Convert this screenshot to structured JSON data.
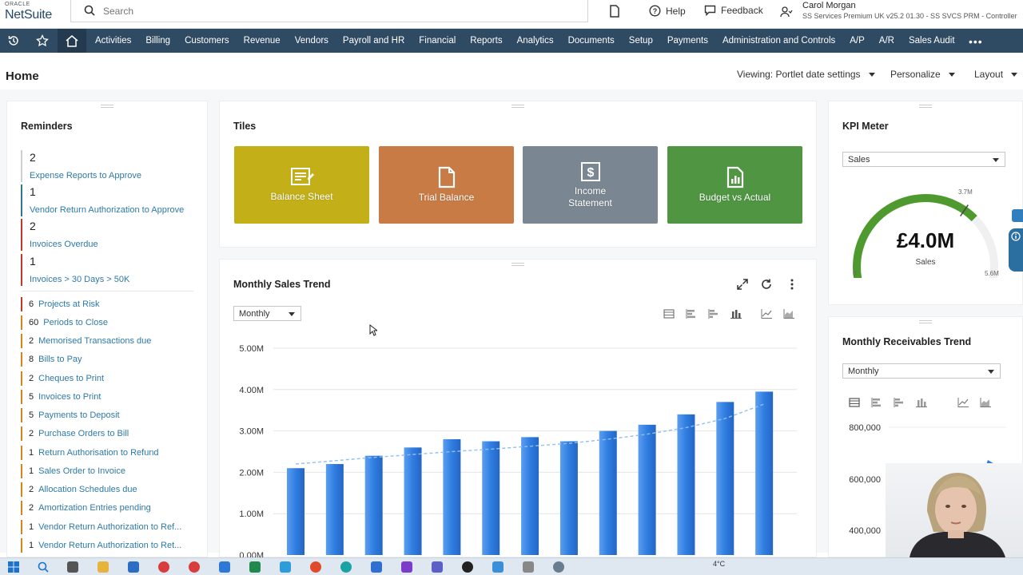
{
  "app": {
    "logo_top": "ORACLE",
    "logo_name": "NetSuite",
    "search_placeholder": "Search",
    "help_label": "Help",
    "feedback_label": "Feedback",
    "user_name": "Carol Morgan",
    "user_role": "SS Services Premium UK v25.2 01.30 - SS SVCS PRM - Controller"
  },
  "nav": {
    "items": [
      "Activities",
      "Billing",
      "Customers",
      "Revenue",
      "Vendors",
      "Payroll and HR",
      "Financial",
      "Reports",
      "Analytics",
      "Documents",
      "Setup",
      "Payments",
      "Administration and Controls",
      "A/P",
      "A/R",
      "Sales Audit"
    ],
    "more": "•••"
  },
  "header": {
    "title": "Home",
    "viewing": "Viewing: Portlet date settings",
    "personalize": "Personalize",
    "layout": "Layout"
  },
  "reminders": {
    "title": "Reminders",
    "big": [
      {
        "count": "2",
        "label": "Expense Reports to Approve",
        "color": "#cfcfcf"
      },
      {
        "count": "1",
        "label": "Vendor Return Authorization to Approve",
        "color": "#2b7a8c"
      },
      {
        "count": "2",
        "label": "Invoices Overdue",
        "color": "#c0392b"
      },
      {
        "count": "1",
        "label": "Invoices > 30 Days > 50K",
        "color": "#c0392b"
      }
    ],
    "small": [
      {
        "count": "6",
        "label": "Projects at Risk",
        "color": "#c0392b"
      },
      {
        "count": "60",
        "label": "Periods to Close",
        "color": "#d4841a"
      },
      {
        "count": "2",
        "label": "Memorised Transactions due",
        "color": "#d4841a"
      },
      {
        "count": "8",
        "label": "Bills to Pay",
        "color": "#d4841a"
      },
      {
        "count": "2",
        "label": "Cheques to Print",
        "color": "#d4841a"
      },
      {
        "count": "5",
        "label": "Invoices to Print",
        "color": "#d4841a"
      },
      {
        "count": "5",
        "label": "Payments to Deposit",
        "color": "#d4841a"
      },
      {
        "count": "2",
        "label": "Purchase Orders to Bill",
        "color": "#d4841a"
      },
      {
        "count": "1",
        "label": "Return Authorisation to Refund",
        "color": "#d4841a"
      },
      {
        "count": "1",
        "label": "Sales Order to Invoice",
        "color": "#d4841a"
      },
      {
        "count": "2",
        "label": "Allocation Schedules due",
        "color": "#d4841a"
      },
      {
        "count": "2",
        "label": "Amortization Entries pending",
        "color": "#d4841a"
      },
      {
        "count": "1",
        "label": "Vendor Return Authorization to Ref...",
        "color": "#d4841a"
      },
      {
        "count": "1",
        "label": "Vendor Return Authorization to Ret...",
        "color": "#d4841a"
      }
    ]
  },
  "tiles": {
    "title": "Tiles",
    "items": [
      {
        "label": "Balance Sheet",
        "color": "#c3b019",
        "icon": "balance-sheet-icon"
      },
      {
        "label": "Trial Balance",
        "color": "#c97b45",
        "icon": "document-icon"
      },
      {
        "label": "Income Statement",
        "color": "#7a8691",
        "icon": "dollar-doc-icon"
      },
      {
        "label": "Budget vs Actual",
        "color": "#4f9542",
        "icon": "chart-doc-icon"
      }
    ]
  },
  "sales_trend": {
    "title": "Monthly Sales Trend",
    "period": "Monthly"
  },
  "kpi": {
    "title": "KPI Meter",
    "select": "Sales",
    "value": "£4.0M",
    "label": "Sales",
    "min": "0",
    "target": "3.7M",
    "max": "5.6M",
    "fill_fraction": 0.71
  },
  "receivables": {
    "title": "Monthly Receivables Trend",
    "period": "Monthly"
  },
  "taskbar": {
    "weather": "4°C"
  },
  "chart_data": [
    {
      "type": "bar",
      "title": "Monthly Sales Trend",
      "xlabel": "",
      "ylabel": "",
      "ylim": [
        0,
        5.0
      ],
      "ytick_labels": [
        "0.00M",
        "1.00M",
        "2.00M",
        "3.00M",
        "4.00M",
        "5.00M"
      ],
      "values": [
        2.1,
        2.2,
        2.4,
        2.6,
        2.8,
        2.75,
        2.85,
        2.75,
        3.0,
        3.15,
        3.4,
        3.7,
        3.95
      ],
      "trend": [
        2.2,
        2.28,
        2.36,
        2.43,
        2.5,
        2.56,
        2.63,
        2.7,
        2.8,
        2.92,
        3.08,
        3.3,
        3.65
      ],
      "color": "#2f7de1",
      "grid": true
    },
    {
      "type": "bar",
      "title": "Monthly Receivables Trend",
      "ytick_labels": [
        "800,000",
        "600,000",
        "400,000"
      ],
      "ylim": [
        300000,
        900000
      ],
      "values": [
        650000
      ],
      "color": "#2f7de1"
    }
  ]
}
